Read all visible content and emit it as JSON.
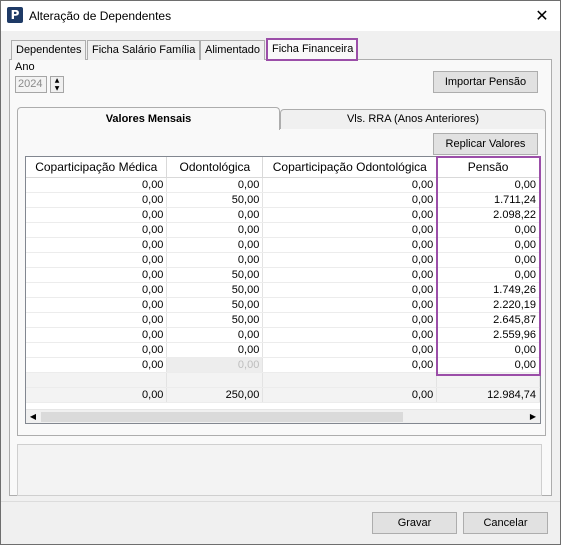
{
  "window": {
    "title": "Alteração de Dependentes",
    "icon": "app-logo-icon",
    "close": "✕"
  },
  "tabs": [
    "Dependentes",
    "Ficha Salário Família",
    "Alimentado",
    "Ficha Financeira"
  ],
  "active_tab": "Ficha Financeira",
  "ano": {
    "label": "Ano",
    "value": "2024"
  },
  "buttons": {
    "importar": "Importar Pensão",
    "replicar": "Replicar Valores",
    "gravar": "Gravar",
    "cancelar": "Cancelar"
  },
  "inner_tabs": [
    "Valores Mensais",
    "Vls. RRA (Anos Anteriores)"
  ],
  "grid": {
    "columns": [
      "Coparticipação Médica",
      "Odontológica",
      "Coparticipação Odontológica",
      "Pensão"
    ],
    "rows": [
      [
        "0,00",
        "0,00",
        "0,00",
        "0,00"
      ],
      [
        "0,00",
        "50,00",
        "0,00",
        "1.711,24"
      ],
      [
        "0,00",
        "0,00",
        "0,00",
        "2.098,22"
      ],
      [
        "0,00",
        "0,00",
        "0,00",
        "0,00"
      ],
      [
        "0,00",
        "0,00",
        "0,00",
        "0,00"
      ],
      [
        "0,00",
        "0,00",
        "0,00",
        "0,00"
      ],
      [
        "0,00",
        "50,00",
        "0,00",
        "0,00"
      ],
      [
        "0,00",
        "50,00",
        "0,00",
        "1.749,26"
      ],
      [
        "0,00",
        "50,00",
        "0,00",
        "2.220,19"
      ],
      [
        "0,00",
        "50,00",
        "0,00",
        "2.645,87"
      ],
      [
        "0,00",
        "0,00",
        "0,00",
        "2.559,96"
      ],
      [
        "0,00",
        "0,00",
        "0,00",
        "0,00"
      ],
      [
        "0,00",
        "0,00",
        "0,00",
        "0,00"
      ]
    ],
    "totals": [
      "0,00",
      "250,00",
      "0,00",
      "12.984,74"
    ]
  },
  "colors": {
    "highlight": "#9b4ea8"
  }
}
